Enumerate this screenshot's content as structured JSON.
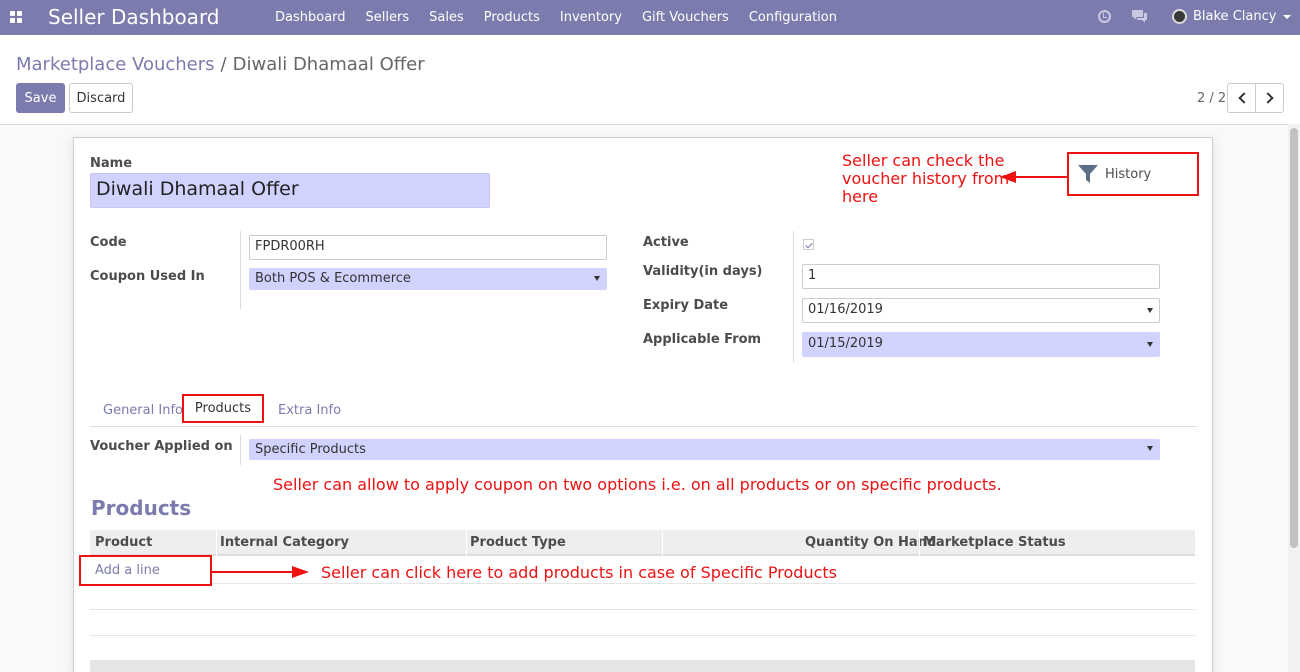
{
  "navbar": {
    "brand": "Seller Dashboard",
    "menu": [
      "Dashboard",
      "Sellers",
      "Sales",
      "Products",
      "Inventory",
      "Gift Vouchers",
      "Configuration"
    ],
    "user_name": "Blake Clancy"
  },
  "breadcrumb": {
    "parent": "Marketplace Vouchers",
    "separator": "/",
    "current": "Diwali Dhamaal Offer"
  },
  "toolbar": {
    "save_label": "Save",
    "discard_label": "Discard"
  },
  "pager": {
    "value": "2 / 2"
  },
  "form": {
    "name_label": "Name",
    "name_value": "Diwali Dhamaal Offer",
    "history_label": "History",
    "code_label": "Code",
    "code_value": "FPDR00RH",
    "coupon_used_in_label": "Coupon Used In",
    "coupon_used_in_value": "Both POS & Ecommerce",
    "active_label": "Active",
    "active_checked": true,
    "validity_label": "Validity(in days)",
    "validity_value": "1",
    "expiry_label": "Expiry Date",
    "expiry_value": "01/16/2019",
    "applicable_label": "Applicable From",
    "applicable_value": "01/15/2019"
  },
  "tabs": [
    "General Info",
    "Products",
    "Extra Info"
  ],
  "active_tab": "Products",
  "products_tab": {
    "voucher_applied_label": "Voucher Applied on",
    "voucher_applied_value": "Specific Products",
    "section_title": "Products",
    "columns": [
      "Product",
      "Internal Category",
      "Product Type",
      "Quantity On Hand",
      "Marketplace Status"
    ],
    "add_line": "Add a line"
  },
  "annotations": {
    "history": [
      "Seller can check the",
      "voucher history from",
      "here"
    ],
    "apply": "Seller can allow to apply coupon on two options i.e. on all products or on specific products.",
    "add_line": "Seller can click here to add products in case of Specific Products"
  },
  "colors": {
    "brand": "#7c7bad",
    "annotation": "#ee1111",
    "required_field": "#d2d2ff"
  }
}
